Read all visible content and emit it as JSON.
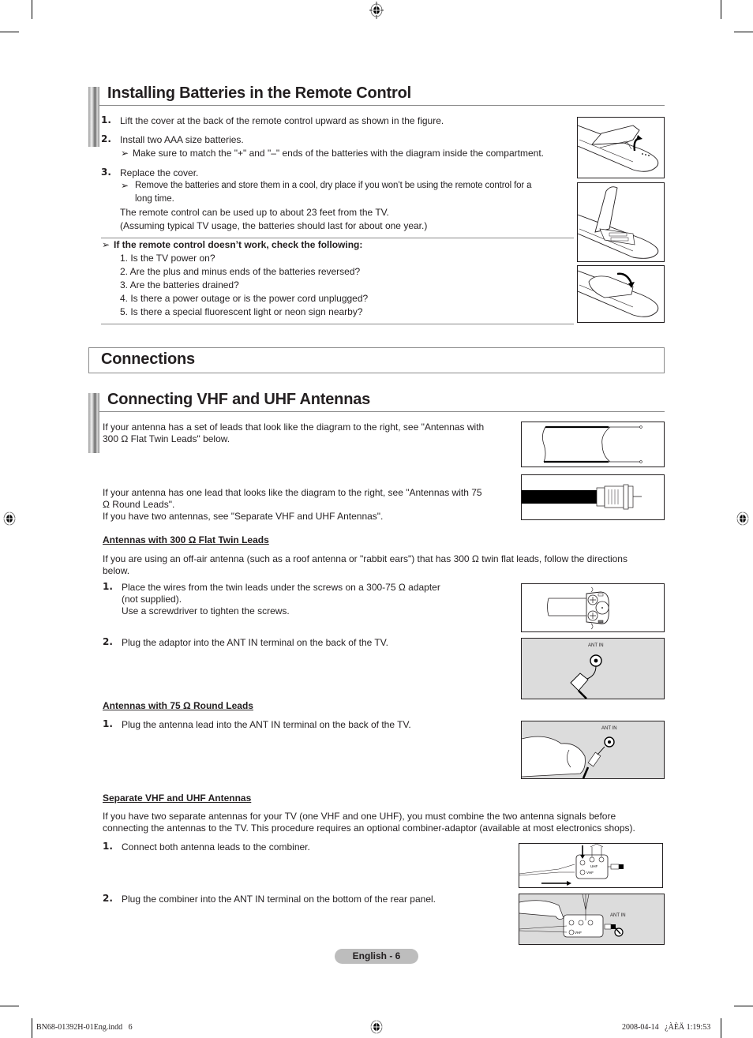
{
  "page": {
    "footer_left": "BN68-01392H-01Eng.indd   6",
    "footer_right": "2008-04-14   ¿ÀÈÄ 1:19:53",
    "page_label": "English - 6"
  },
  "batteries": {
    "title": "Installing Batteries in the Remote Control",
    "steps": [
      {
        "num": "1.",
        "text": "Lift the cover at the back of the remote control upward as shown in the figure."
      },
      {
        "num": "2.",
        "text": "Install two AAA size batteries.",
        "note": "Make sure to match the \"+\" and \"–\" ends of the batteries with the diagram inside the compartment."
      },
      {
        "num": "3.",
        "text": "Replace the cover.",
        "note_line1": "Remove the batteries and store them in a cool, dry place if you won’t be using the remote control for a",
        "note_line2": "long time.",
        "extra1": "The remote control can be used up to about 23 feet from the TV.",
        "extra2": "(Assuming typical TV usage, the batteries should last for about one year.)"
      }
    ],
    "check_title": "If the remote control doesn’t work, check the following:",
    "check_items": [
      "1. Is the TV power on?",
      "2. Are the plus and minus ends of the batteries reversed?",
      "3. Are the batteries drained?",
      "4. Is there a power outage or is the power cord unplugged?",
      "5. Is there a special fluorescent light or neon sign nearby?"
    ],
    "note_marker": "➢"
  },
  "connections": {
    "title": "Connections"
  },
  "antennas": {
    "title": "Connecting VHF and UHF Antennas",
    "intro1_line1": "If your antenna has a set of leads that look like the diagram to the right, see \"Antennas with",
    "intro1_line2": "300 Ω Flat Twin Leads\" below.",
    "intro2_line1": "If your antenna has one lead that looks like the diagram to the right, see \"Antennas with 75",
    "intro2_line2": "Ω Round Leads\".",
    "intro2_line3": "If you have two antennas, see \"Separate VHF and UHF Antennas\".",
    "flat": {
      "title": "Antennas with 300 Ω Flat Twin Leads",
      "desc_line1": "If you are using an off-air antenna (such as a roof antenna or \"rabbit ears\") that has 300 Ω twin flat leads, follow the directions",
      "desc_line2": "below.",
      "steps": [
        {
          "num": "1.",
          "line1": "Place the wires from the twin leads under the screws on a 300-75 Ω adapter",
          "line2": "(not supplied).",
          "line3": "Use a screwdriver to tighten the screws."
        },
        {
          "num": "2.",
          "line1": "Plug the adaptor into the ANT IN terminal on the back of the TV."
        }
      ],
      "fig_label": "ANT IN"
    },
    "round": {
      "title": "Antennas with 75 Ω Round Leads",
      "steps": [
        {
          "num": "1.",
          "line1": "Plug the antenna lead into the ANT IN terminal on the back of the TV."
        }
      ],
      "fig_label": "ANT IN"
    },
    "separate": {
      "title": "Separate VHF and UHF Antennas",
      "desc_line1": "If you have two separate antennas for your TV (one VHF and one UHF), you must combine the two antenna signals before",
      "desc_line2": "connecting the antennas to the TV. This procedure requires an optional combiner-adaptor (available at most electronics shops).",
      "steps": [
        {
          "num": "1.",
          "line1": "Connect both antenna leads to the combiner."
        },
        {
          "num": "2.",
          "line1": "Plug the combiner into the ANT IN terminal on the bottom of the rear panel."
        }
      ],
      "uhf_label": "UHF",
      "vhf_label": "VHF",
      "fig_label": "ANT IN"
    }
  }
}
